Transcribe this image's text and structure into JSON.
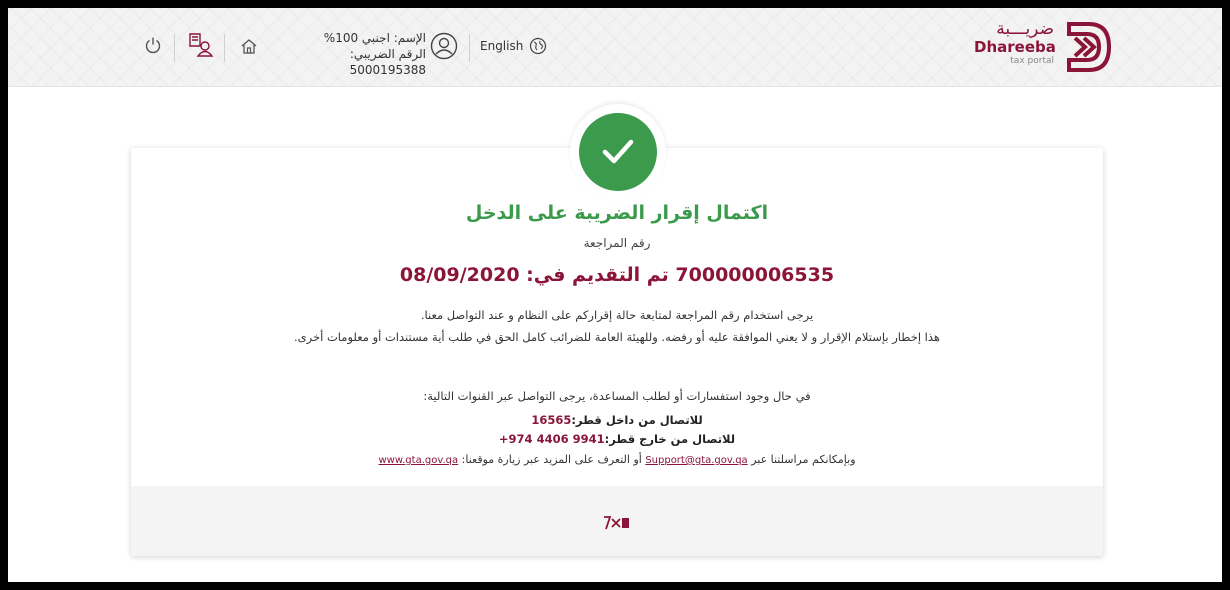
{
  "header": {
    "logo": {
      "arabic": "ضريـــبة",
      "english": "Dhareeba",
      "sub": "tax portal"
    },
    "language_label": "English",
    "user_name": "الإسم: اجنبي 100%",
    "tax_number": "الرقم الضريبي: 5000195388"
  },
  "confirmation": {
    "title": "اكتمال إقرار الضريبة على الدخل",
    "ref_label": "رقم المراجعة",
    "ref_number": "700000006535",
    "submitted_text": "تم التقديم في:",
    "submitted_date": "08/09/2020",
    "note1": "يرجى استخدام رقم المراجعة لمتابعة حالة إقراركم على النظام و عند التواصل معنا.",
    "note2": "هذا إخطار بإستلام الإقرار و لا يعني الموافقة عليه أو رفضه. وللهيئة العامة للضرائب كامل الحق في طلب أية مستندات أو معلومات أخرى."
  },
  "contact": {
    "help_text": "في حال وجود استفسارات أو لطلب المساعدة، يرجى التواصل عبر القنوات التالية:",
    "inside_label": "للاتصال من داخل قطر:",
    "inside_number": "16565",
    "outside_label": "للاتصال من خارج قطر:",
    "outside_number": "9941 4406 974+",
    "mail_prefix": "وبإمكانكم مراسلتنا عبر",
    "email": "Support@gta.gov.qa",
    "mail_middle": "أو التعرف على المزيد عبر زيارة موقعنا:",
    "website": "www.gta.gov.qa"
  },
  "colors": {
    "brand": "#8a1538",
    "success": "#3c9a4d"
  },
  "icons": [
    "logo-icon",
    "globe-icon",
    "user-icon",
    "home-icon",
    "profile-icon",
    "power-icon",
    "check-icon",
    "gta-footer-logo"
  ]
}
